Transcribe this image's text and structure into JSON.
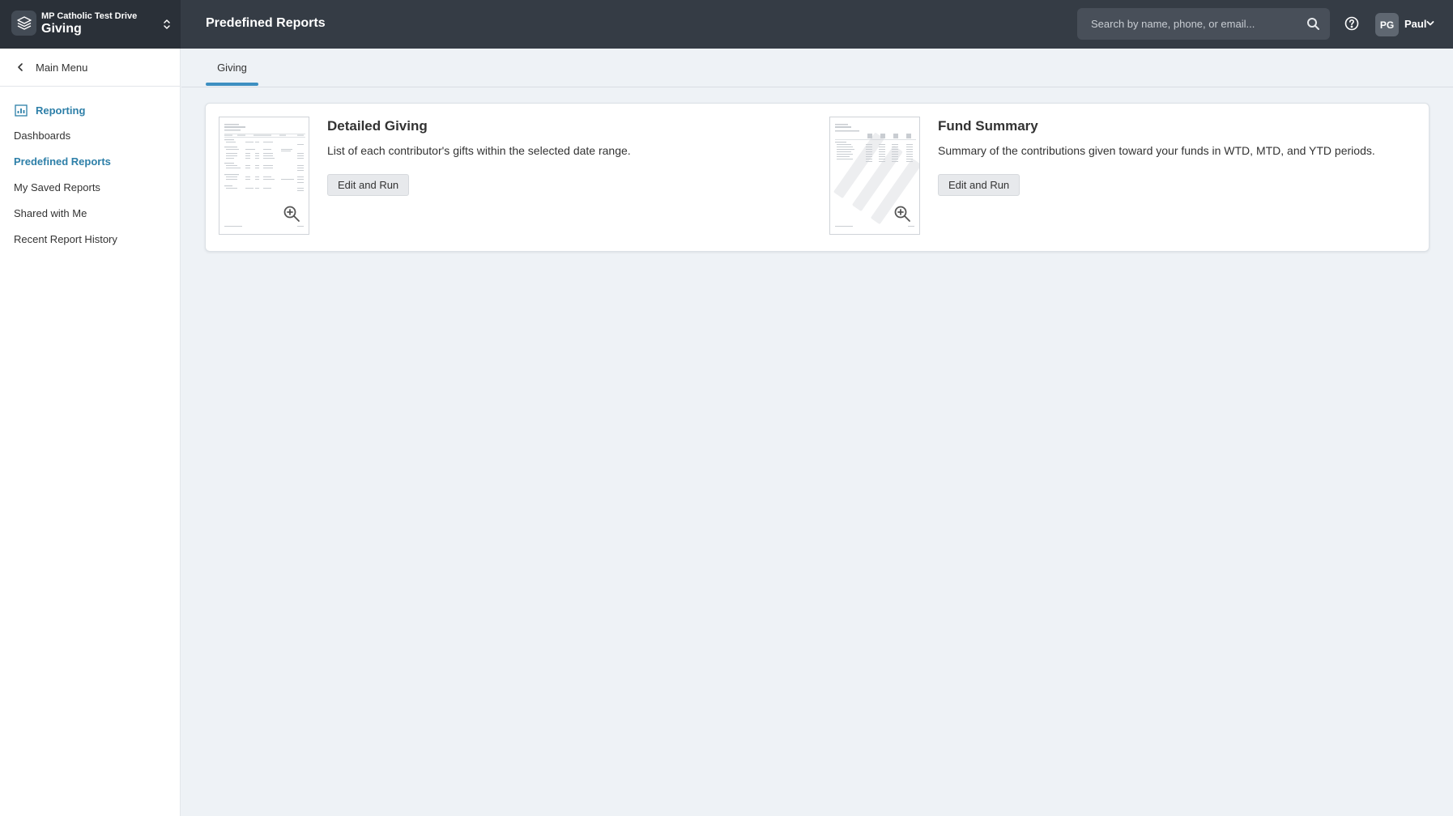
{
  "app": {
    "org_name": "MP Catholic Test Drive",
    "module_name": "Giving"
  },
  "header": {
    "page_title": "Predefined Reports",
    "search_placeholder": "Search by name, phone, or email...",
    "user_initials": "PG",
    "user_name": "Paul"
  },
  "sidebar": {
    "back_label": "Main Menu",
    "section_label": "Reporting",
    "items": [
      {
        "label": "Dashboards"
      },
      {
        "label": "Predefined Reports"
      },
      {
        "label": "My Saved Reports"
      },
      {
        "label": "Shared with Me"
      },
      {
        "label": "Recent Report History"
      }
    ]
  },
  "tabs": [
    {
      "label": "Giving"
    }
  ],
  "reports": [
    {
      "title": "Detailed Giving",
      "description": "List of each contributor's gifts within the selected date range.",
      "button_label": "Edit and Run"
    },
    {
      "title": "Fund Summary",
      "description": "Summary of the contributions given toward your funds in WTD, MTD, and YTD periods.",
      "button_label": "Edit and Run"
    }
  ],
  "colors": {
    "topbar": "#353c45",
    "accent": "#2d7fa8",
    "tab_underline": "#3d8fc1",
    "background": "#eef2f6"
  },
  "icons": {
    "app_logo": "layers-icon",
    "app_switch": "chevron-updown-icon",
    "search": "search-icon",
    "help": "help-circle-icon",
    "user_menu": "chevron-down-icon",
    "back": "chevron-left-icon",
    "reporting": "bar-chart-icon",
    "preview": "zoom-in-icon"
  }
}
